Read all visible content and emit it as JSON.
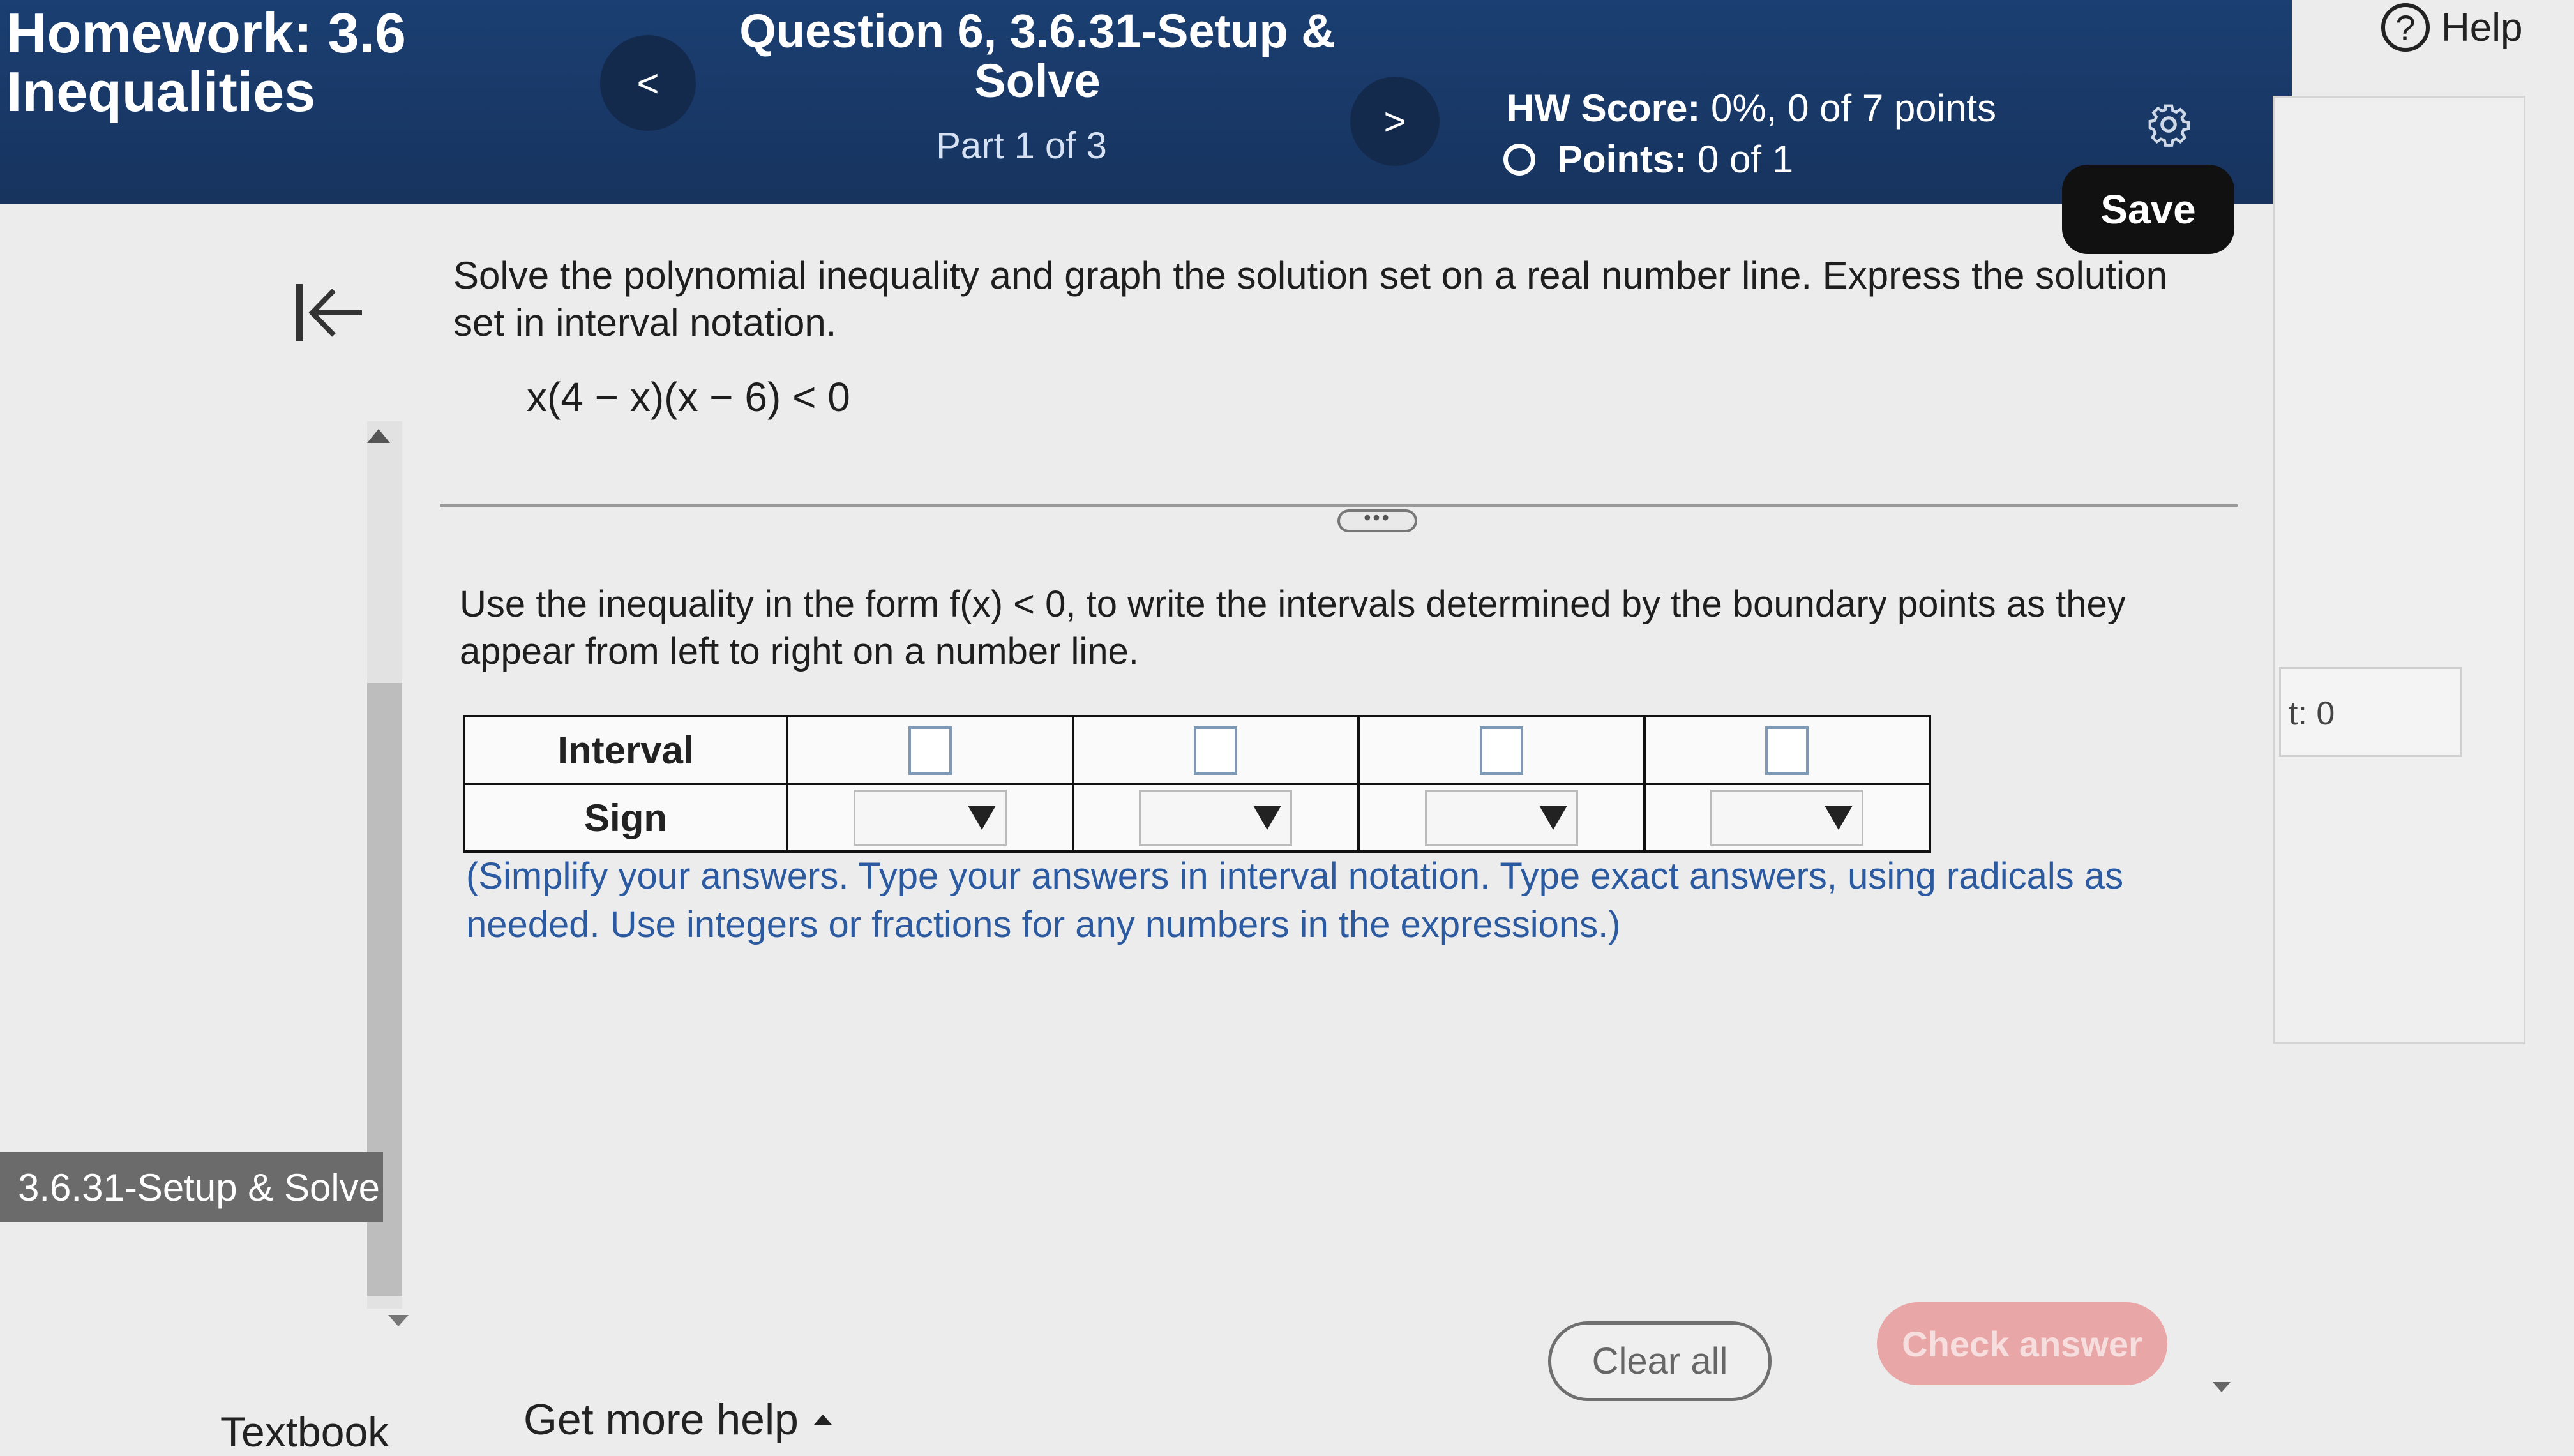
{
  "header": {
    "homework_title_line1": "Homework: 3.6",
    "homework_title_line2": "Inequalities",
    "prev_symbol": "<",
    "next_symbol": ">",
    "question_title_line1": "Question 6, 3.6.31-Setup &",
    "question_title_line2": "Solve",
    "part": "Part 1 of 3",
    "hw_score_label": "HW Score:",
    "hw_score_value": "0%, 0 of 7 points",
    "points_label": "Points:",
    "points_value": "0 of 1",
    "save_label": "Save"
  },
  "help": {
    "symbol": "?",
    "label": "Help"
  },
  "right_field_text": "t: 0",
  "sidebar": {
    "collapse_symbol": "|←",
    "item_label": "3.6.31-Setup & Solve"
  },
  "question": {
    "prompt": "Solve the polynomial inequality and graph the solution set on a real number line. Express the solution set in interval notation.",
    "expression": "x(4 − x)(x − 6) < 0",
    "ellipsis": "•••",
    "instructions": "Use the inequality in the form f(x) < 0, to write the intervals determined by the boundary points as they appear from left to right on a number line.",
    "table": {
      "row_interval_label": "Interval",
      "row_sign_label": "Sign",
      "interval_values": [
        "",
        "",
        "",
        ""
      ],
      "sign_selected": [
        "",
        "",
        "",
        ""
      ]
    },
    "note": "(Simplify your answers. Type your answers in interval notation. Type exact answers, using radicals as needed. Use integers or fractions for any numbers in the expressions.)"
  },
  "footer": {
    "clear_label": "Clear all",
    "check_label": "Check answer",
    "textbook_label": "Textbook",
    "more_help_label": "Get more help"
  },
  "colors": {
    "header_bg": "#1b3f72",
    "save_bg": "#111111",
    "note_text": "#2c5aa0",
    "check_bg": "#e8a6a6"
  }
}
